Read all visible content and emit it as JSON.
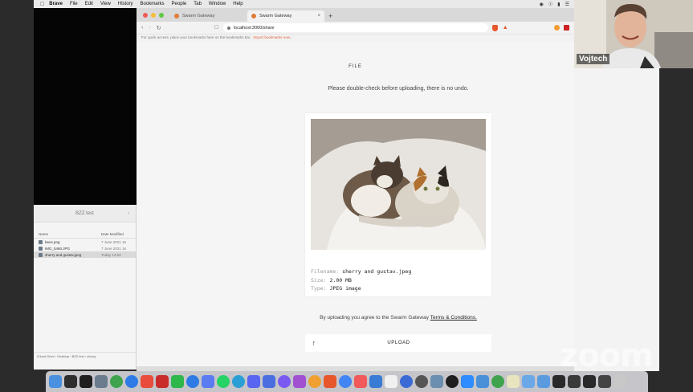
{
  "menubar": {
    "app_name": "Brave",
    "items": [
      "File",
      "Edit",
      "View",
      "History",
      "Bookmarks",
      "People",
      "Tab",
      "Window",
      "Help"
    ]
  },
  "finder": {
    "title": "BZZ test",
    "col_name": "Name",
    "col_date": "Date Modified",
    "files": [
      {
        "name": "bees.png",
        "date": "7 June 2021 16"
      },
      {
        "name": "IMG_5460.JPG",
        "date": "7 June 2021 16"
      },
      {
        "name": "sherry and gustav.jpeg",
        "date": "Today 14:53"
      }
    ],
    "path": "iCloud Drive › Desktop › BZZ test › sherry"
  },
  "browser": {
    "tabs": [
      {
        "label": "Swarm Gateway",
        "active": false
      },
      {
        "label": "Swarm Gateway",
        "active": true
      }
    ],
    "url": "localhost:3000/share",
    "bookmarks_hint": "For quick access, place your bookmarks here on the bookmarks bar.",
    "bookmarks_link": "Import bookmarks now..."
  },
  "page": {
    "heading": "FILE",
    "warning": "Please double-check before uploading, there is no undo.",
    "file": {
      "filename_label": "Filename:",
      "filename": "sherry and gustav.jpeg",
      "size_label": "Size:",
      "size": "2.00 MB",
      "type_label": "Type:",
      "type": "JPEG image"
    },
    "agree_text": "By uploading you agree to the Swarm Gateway",
    "terms_link": "Terms & Conditions.",
    "upload_label": "UPLOAD"
  },
  "video": {
    "participant": "Vojtech"
  },
  "zoom_logo": "zoom",
  "colors": {
    "accent_orange": "#e4643b",
    "brave_orange": "#e8562b"
  }
}
